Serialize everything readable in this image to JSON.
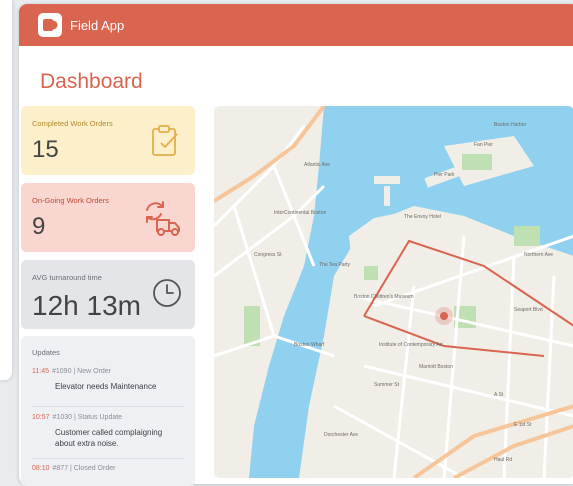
{
  "app": {
    "title": "Field App"
  },
  "page": {
    "title": "Dashboard"
  },
  "cards": {
    "completed": {
      "label": "Completed Work Orders",
      "value": "15",
      "icon": "clipboard-check-icon"
    },
    "ongoing": {
      "label": "On-Going Work Orders",
      "value": "9",
      "icon": "truck-refresh-icon"
    },
    "avg": {
      "label": "AVG turnaround time",
      "value": "12h 13m",
      "icon": "clock-icon"
    }
  },
  "updates": {
    "title": "Updates",
    "items": [
      {
        "time": "11:45",
        "meta": "#1090 | New Order",
        "message": "Elevator needs Maintenance"
      },
      {
        "time": "10:57",
        "meta": "#1030 | Status Update",
        "message": "Customer called complaigning about extra noise."
      },
      {
        "time": "08:10",
        "meta": "#877 | Closed Order",
        "message": ""
      }
    ]
  },
  "map": {
    "labels": {
      "pier_park": "Pier Park",
      "continental_station": "InterContinental Boston",
      "envoy_hotel": "The Envoy Hotel",
      "tea_party": "The Tea Party",
      "childrens_museum": "Boston Children's Museum",
      "boston_wharf": "Boston Wharf",
      "ica": "Institute of Contemporary Art",
      "marriott": "Marriott Boston",
      "congress_st": "Congress St",
      "summer_st": "Summer St",
      "seaport_blvd": "Seaport Blvd",
      "northern_ave": "Northern Ave",
      "a_st": "A St",
      "dorchester_ave": "Dorchester Ave",
      "east_first_st": "E 1st St",
      "haul_rd": "Haul Rd",
      "boston_harbor": "Boston Harbor",
      "fan_pier": "Fan Pier",
      "atlantic_ave": "Atlantic Ave"
    },
    "colors": {
      "route": "#d9644f",
      "water": "#8fd1ee",
      "park": "#bfe0b2"
    }
  },
  "theme": {
    "accent": "#d9644f"
  }
}
